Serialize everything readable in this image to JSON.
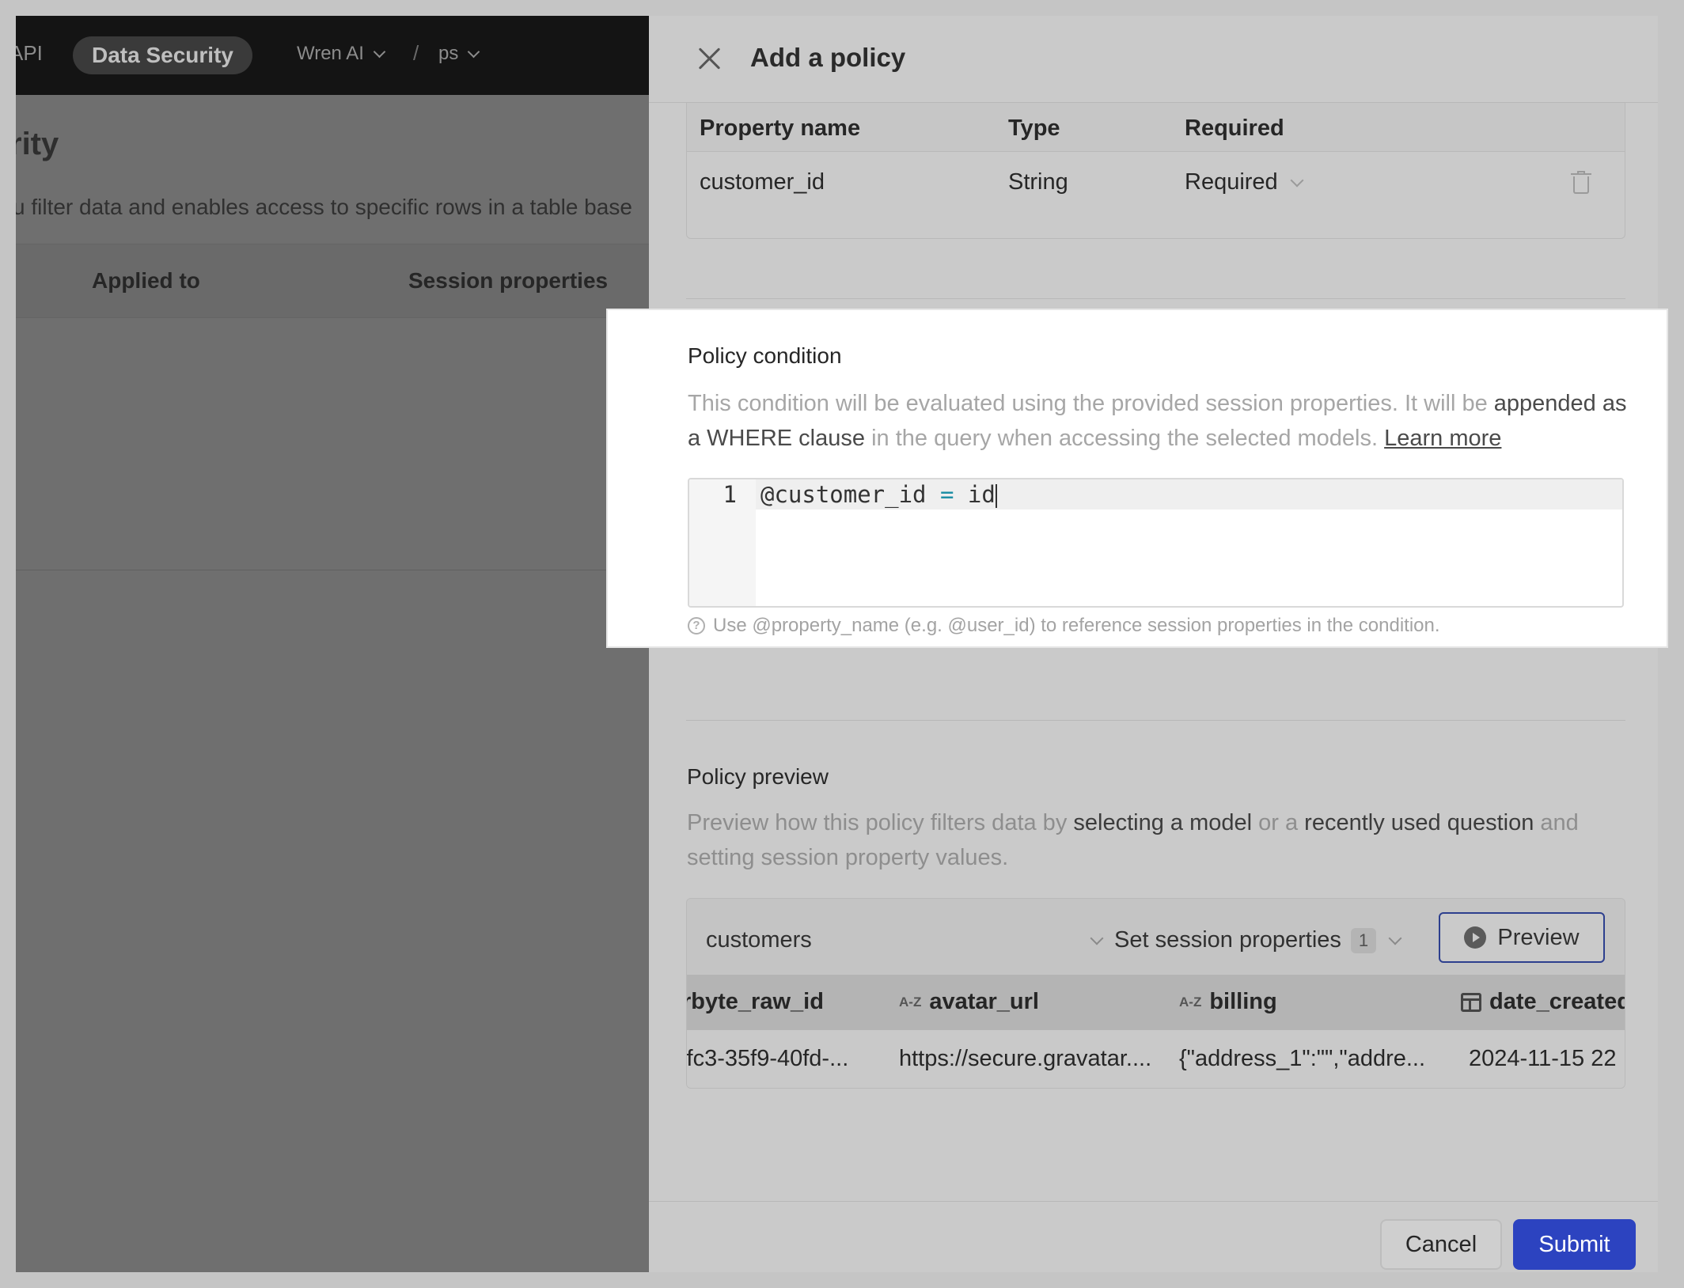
{
  "background_app": {
    "nav": {
      "api_tab": "API",
      "active_tab": "Data Security",
      "project": "Wren AI",
      "separator": "/",
      "branch": "ps"
    },
    "page_title": "rity",
    "page_description": "u filter data and enables access to specific rows in a table base",
    "table_headers": [
      "Applied to",
      "Session properties"
    ]
  },
  "drawer": {
    "title": "Add a policy",
    "session_properties_table": {
      "headers": [
        "Property name",
        "Type",
        "Required"
      ],
      "rows": [
        {
          "name": "customer_id",
          "type": "String",
          "required": "Required"
        }
      ]
    },
    "policy_condition": {
      "title": "Policy condition",
      "description_before": "This condition will be evaluated using the provided session properties. It will be ",
      "description_strong1": "appended as a WHERE clause",
      "description_after": " in the query when accessing the selected models. ",
      "learn_more": "Learn more",
      "editor": {
        "line_number": "1",
        "code_variable": "@customer_id",
        "code_operator": "=",
        "code_value": "id"
      },
      "hint": "Use @property_name (e.g. @user_id) to reference session properties in the condition."
    },
    "policy_preview": {
      "title": "Policy preview",
      "desc_1": "Preview how this policy filters data by ",
      "desc_strong1": "selecting a model",
      "desc_2": " or a ",
      "desc_strong2": "recently used question",
      "desc_3": " and setting session property values.",
      "model_select": "customers",
      "session_select": "Set session properties",
      "session_count": "1",
      "preview_button": "Preview",
      "grid": {
        "columns": [
          {
            "name": "byte_raw_id",
            "prefix": "r",
            "icon": ""
          },
          {
            "name": "avatar_url",
            "prefix": "",
            "icon": "A-Z"
          },
          {
            "name": "billing",
            "prefix": "",
            "icon": "A-Z"
          },
          {
            "name": "date_created",
            "prefix": "",
            "icon": "calendar"
          }
        ],
        "row": [
          "'fc3-35f9-40fd-...",
          "https://secure.gravatar....",
          "{\"address_1\":\"\",\"addre...",
          "2024-11-15 22"
        ]
      }
    },
    "footer": {
      "cancel": "Cancel",
      "submit": "Submit"
    }
  }
}
